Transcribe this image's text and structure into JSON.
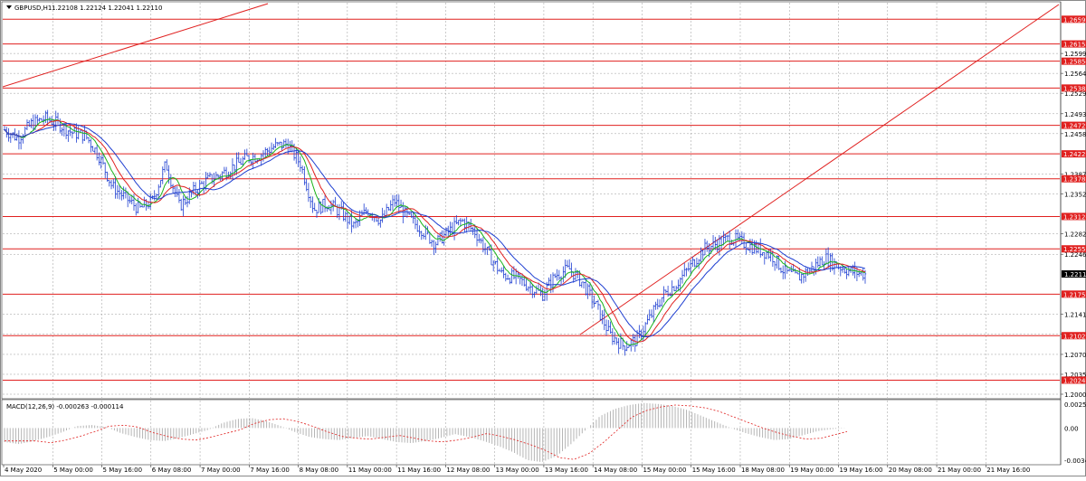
{
  "window": {
    "symbol_header": "GBPUSD,H1",
    "ohlc": "1.22108 1.22124 1.22041 1.22110",
    "collapse_icon": "triangle-down-icon"
  },
  "colors": {
    "background": "#ffffff",
    "bull_bear_bars": "#1f3fd1",
    "level_line": "#e0201f",
    "level_label_bg": "#e0201f",
    "ma_fast": "#19b319",
    "ma_mid": "#e0201f",
    "ma_slow": "#1f3fd1",
    "grid": "#9a9a9a",
    "macd_histogram": "#b5b5b5",
    "macd_signal": "#e0201f",
    "current_price_bg": "#000000"
  },
  "price_axis": {
    "ticks": [
      "1.25990",
      "1.25640",
      "1.25290",
      "1.24930",
      "1.24580",
      "1.23870",
      "1.23520",
      "1.22820",
      "1.22460",
      "1.21410",
      "1.21060",
      "1.20700",
      "1.20350",
      "1.20000"
    ],
    "current_price": "1.22110"
  },
  "levels": [
    "1.26591",
    "1.26157",
    "1.25854",
    "1.25382",
    "1.24727",
    "1.24225",
    "1.23787",
    "1.23124",
    "1.22555",
    "1.21759",
    "1.21029",
    "1.20247"
  ],
  "time_axis": {
    "labels": [
      "4 May 2020",
      "5 May 00:00",
      "5 May 16:00",
      "6 May 08:00",
      "7 May 00:00",
      "7 May 16:00",
      "8 May 08:00",
      "11 May 00:00",
      "11 May 16:00",
      "12 May 08:00",
      "13 May 00:00",
      "13 May 16:00",
      "14 May 08:00",
      "15 May 00:00",
      "15 May 16:00",
      "18 May 08:00",
      "19 May 00:00",
      "19 May 16:00",
      "20 May 08:00",
      "21 May 00:00",
      "21 May 16:00"
    ]
  },
  "macd_panel": {
    "header": "MACD(12,26,9) -0.000263 -0.000114",
    "ticks": [
      "0.002563",
      "0.00",
      "-0.00348"
    ]
  },
  "chart_data": {
    "type": "candlestick",
    "symbol": "GBPUSD",
    "timeframe": "H1",
    "y_range": [
      1.2,
      1.2685
    ],
    "support_resistance_levels": [
      1.26591,
      1.26157,
      1.25854,
      1.25382,
      1.24727,
      1.24225,
      1.23787,
      1.23124,
      1.22555,
      1.21759,
      1.21029,
      1.20247
    ],
    "price_path": [
      1.2465,
      1.245,
      1.2475,
      1.2485,
      1.2475,
      1.246,
      1.2455,
      1.242,
      1.2365,
      1.2345,
      1.2325,
      1.234,
      1.2405,
      1.233,
      1.2355,
      1.2375,
      1.2385,
      1.24,
      1.2415,
      1.242,
      1.2435,
      1.244,
      1.2405,
      1.2325,
      1.2335,
      1.232,
      1.2295,
      1.2325,
      1.2305,
      1.234,
      1.231,
      1.229,
      1.2265,
      1.2285,
      1.2305,
      1.2285,
      1.2245,
      1.221,
      1.2205,
      1.219,
      1.2175,
      1.221,
      1.222,
      1.2195,
      1.2155,
      1.2105,
      1.2085,
      1.2095,
      1.2135,
      1.2175,
      1.2195,
      1.2225,
      1.2255,
      1.2265,
      1.2275,
      1.2265,
      1.2255,
      1.2245,
      1.2215,
      1.2205,
      1.222,
      1.224,
      1.2225,
      1.2215,
      1.2211
    ],
    "macd_histogram": [
      -0.0014,
      -0.0016,
      -0.0013,
      -0.0009,
      -0.0004,
      0.0002,
      0.0003,
      0.0001,
      -0.0005,
      -0.0009,
      -0.0012,
      -0.0013,
      -0.001,
      -0.0006,
      -0.0002,
      0.0005,
      0.0009,
      0.001,
      0.0007,
      0.0002,
      -0.0004,
      -0.0009,
      -0.0011,
      -0.0012,
      -0.001,
      -0.0008,
      -0.0011,
      -0.0014,
      -0.0015,
      -0.0013,
      -0.001,
      -0.0006,
      -0.0009,
      -0.0013,
      -0.0018,
      -0.0024,
      -0.0032,
      -0.0034,
      -0.0028,
      -0.0016,
      -0.0002,
      0.0012,
      0.0019,
      0.0023,
      0.0025,
      0.0024,
      0.0022,
      0.0018,
      0.0012,
      0.0006,
      0.0,
      -0.0005,
      -0.0009,
      -0.0012,
      -0.0011,
      -0.0007,
      -0.0003,
      -0.0001,
      0.0
    ],
    "macd_y_range": [
      -0.00348,
      0.002563
    ]
  }
}
